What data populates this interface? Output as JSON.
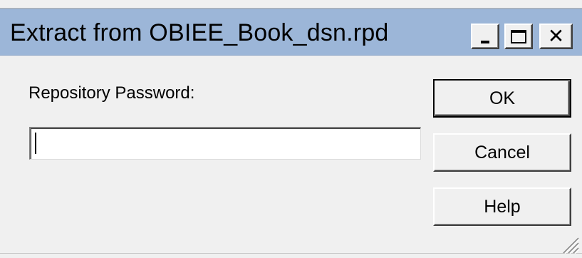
{
  "window": {
    "title": "Extract from OBIEE_Book_dsn.rpd",
    "controls": {
      "minimize_icon": "minimize-icon",
      "maximize_icon": "maximize-icon",
      "close_icon": "close-icon",
      "close_glyph": "✕"
    },
    "titlebar_color": "#9cb6d8"
  },
  "form": {
    "password_label": "Repository Password:",
    "password_value": "",
    "password_placeholder": ""
  },
  "buttons": {
    "ok_label": "OK",
    "cancel_label": "Cancel",
    "help_label": "Help"
  },
  "icons": {
    "resize_grip": "resize-grip-icon"
  }
}
